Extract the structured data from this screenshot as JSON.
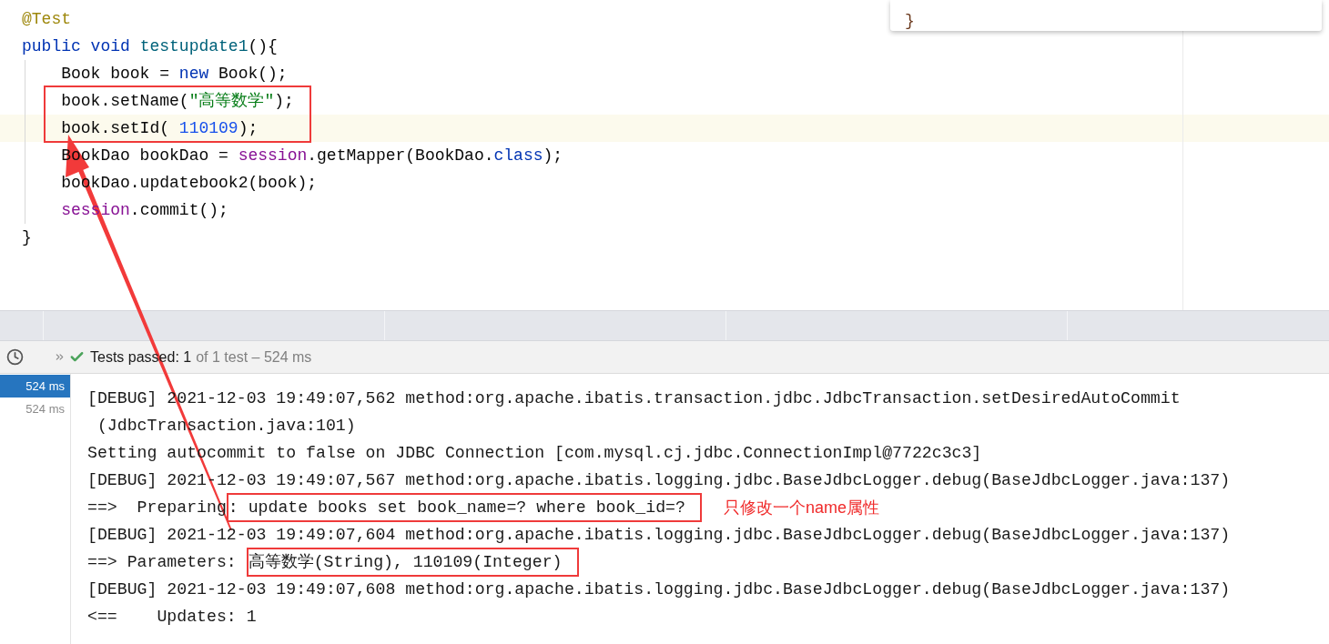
{
  "editor": {
    "lines": [
      {
        "current": false,
        "boxed": false,
        "tokens": [
          {
            "text": "@Test",
            "kind": "annotation"
          }
        ]
      },
      {
        "current": false,
        "boxed": false,
        "tokens": [
          {
            "text": "public void ",
            "kind": "keyword"
          },
          {
            "text": "testupdate1",
            "kind": "method"
          },
          {
            "text": "(){",
            "kind": "plain"
          }
        ]
      },
      {
        "current": false,
        "boxed": false,
        "tokens": [
          {
            "text": "    Book book = ",
            "kind": "plain"
          },
          {
            "text": "new ",
            "kind": "keyword"
          },
          {
            "text": "Book();",
            "kind": "plain"
          }
        ]
      },
      {
        "current": false,
        "boxed": true,
        "tokens": [
          {
            "text": "    book.setName(",
            "kind": "plain"
          },
          {
            "text": "\"高等数学\"",
            "kind": "string"
          },
          {
            "text": ");",
            "kind": "plain"
          }
        ]
      },
      {
        "current": true,
        "boxed": true,
        "tokens": [
          {
            "text": "    book.setId( ",
            "kind": "plain"
          },
          {
            "text": "110109",
            "kind": "number"
          },
          {
            "text": ");",
            "kind": "plain"
          }
        ]
      },
      {
        "current": false,
        "boxed": false,
        "tokens": [
          {
            "text": "    BookDao bookDao = ",
            "kind": "plain"
          },
          {
            "text": "session",
            "kind": "field"
          },
          {
            "text": ".getMapper(BookDao.",
            "kind": "plain"
          },
          {
            "text": "class",
            "kind": "keyword"
          },
          {
            "text": ");",
            "kind": "plain"
          }
        ]
      },
      {
        "current": false,
        "boxed": false,
        "tokens": [
          {
            "text": "    bookDao.updatebook2(book);",
            "kind": "plain"
          }
        ]
      },
      {
        "current": false,
        "boxed": false,
        "tokens": [
          {
            "text": "    session",
            "kind": "field"
          },
          {
            "text": ".commit();",
            "kind": "plain"
          }
        ]
      },
      {
        "current": false,
        "boxed": false,
        "tokens": [
          {
            "text": "}",
            "kind": "plain"
          }
        ]
      }
    ]
  },
  "popup": {
    "lines": [
      "}"
    ]
  },
  "run_toolbar": {
    "passed": true,
    "status": "Tests passed: 1",
    "detail": "of 1 test – 524 ms"
  },
  "results": [
    {
      "duration": "524 ms",
      "selected": true
    },
    {
      "duration": "524 ms",
      "selected": false
    }
  ],
  "console": {
    "lines": [
      {
        "tokens": [
          {
            "text": "[DEBUG] 2021-12-03 19:49:07,562 method:org.apache.ibatis.transaction.jdbc.JdbcTransaction.setDesiredAutoCommit",
            "kind": "text"
          }
        ]
      },
      {
        "tokens": [
          {
            "text": " (JdbcTransaction.java:101)",
            "kind": "text"
          }
        ]
      },
      {
        "tokens": [
          {
            "text": "Setting autocommit to false on JDBC Connection [com.mysql.cj.jdbc.ConnectionImpl@7722c3c3]",
            "kind": "text"
          }
        ]
      },
      {
        "tokens": [
          {
            "text": "[DEBUG] 2021-12-03 19:49:07,567 method:org.apache.ibatis.logging.jdbc.BaseJdbcLogger.debug(BaseJdbcLogger.java:137)",
            "kind": "text"
          }
        ]
      },
      {
        "tokens": [
          {
            "text": "==>  Preparing",
            "kind": "text"
          },
          {
            "text": ": update books set book_name=? where book_id=?",
            "kind": "boxed"
          },
          {
            "text": "只修改一个name属性",
            "kind": "note"
          }
        ]
      },
      {
        "tokens": [
          {
            "text": "[DEBUG] 2021-12-03 19:49:07,604 method:org.apache.ibatis.logging.jdbc.BaseJdbcLogger.debug(BaseJdbcLogger.java:137)",
            "kind": "text"
          }
        ]
      },
      {
        "tokens": [
          {
            "text": "==> Parameters: ",
            "kind": "text"
          },
          {
            "text": "高等数学(String), 110109(Integer)",
            "kind": "boxed"
          }
        ]
      },
      {
        "tokens": [
          {
            "text": "[DEBUG] 2021-12-03 19:49:07,608 method:org.apache.ibatis.logging.jdbc.BaseJdbcLogger.debug(BaseJdbcLogger.java:137)",
            "kind": "text"
          }
        ]
      },
      {
        "tokens": [
          {
            "text": "<==    Updates: 1",
            "kind": "text"
          }
        ]
      }
    ]
  }
}
